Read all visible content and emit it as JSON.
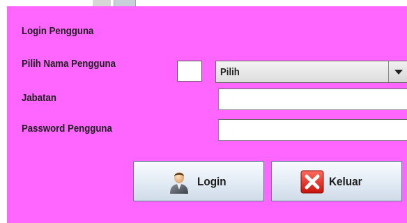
{
  "window": {
    "title": "Login Pengguna"
  },
  "form": {
    "username_label": "Pilih Nama Pengguna",
    "username_select_value": "Pilih",
    "position_label": "Jabatan",
    "position_value": "",
    "password_label": "Password Pengguna",
    "password_value": ""
  },
  "buttons": {
    "login_label": "Login",
    "login_icon": "user-icon",
    "exit_label": "Keluar",
    "exit_icon": "close-icon"
  },
  "colors": {
    "panel_background": "#ff66ff",
    "exit_icon_red": "#e8261d"
  }
}
